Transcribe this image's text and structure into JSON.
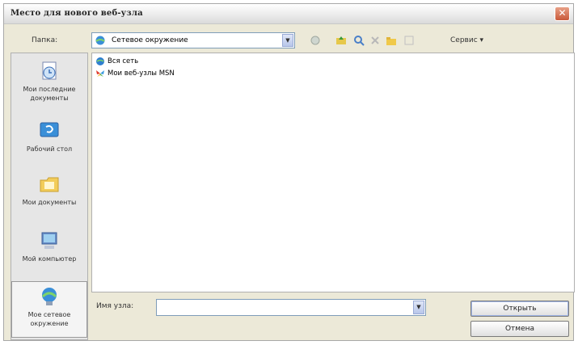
{
  "window": {
    "title": "Место для нового веб-узла",
    "close": "✕"
  },
  "toolbar": {
    "folder_label": "Папка:",
    "location": "Сетевое окружение",
    "dropdown": "▼",
    "service": "Сервис ▾"
  },
  "places": [
    {
      "label": "Мои последние документы",
      "icon": "recent-documents-icon"
    },
    {
      "label": "Рабочий стол",
      "icon": "desktop-icon"
    },
    {
      "label": "Мои документы",
      "icon": "my-documents-icon"
    },
    {
      "label": "Мой компьютер",
      "icon": "my-computer-icon"
    },
    {
      "label": "Мое сетевое окружение",
      "icon": "network-places-icon"
    }
  ],
  "files": [
    {
      "name": "Вся сеть",
      "icon": "entire-network-icon"
    },
    {
      "name": "Мои веб-узлы MSN",
      "icon": "msn-butterfly-icon"
    }
  ],
  "footer": {
    "name_label": "Имя узла:",
    "name_value": "",
    "open": "Открыть",
    "cancel": "Отмена"
  }
}
